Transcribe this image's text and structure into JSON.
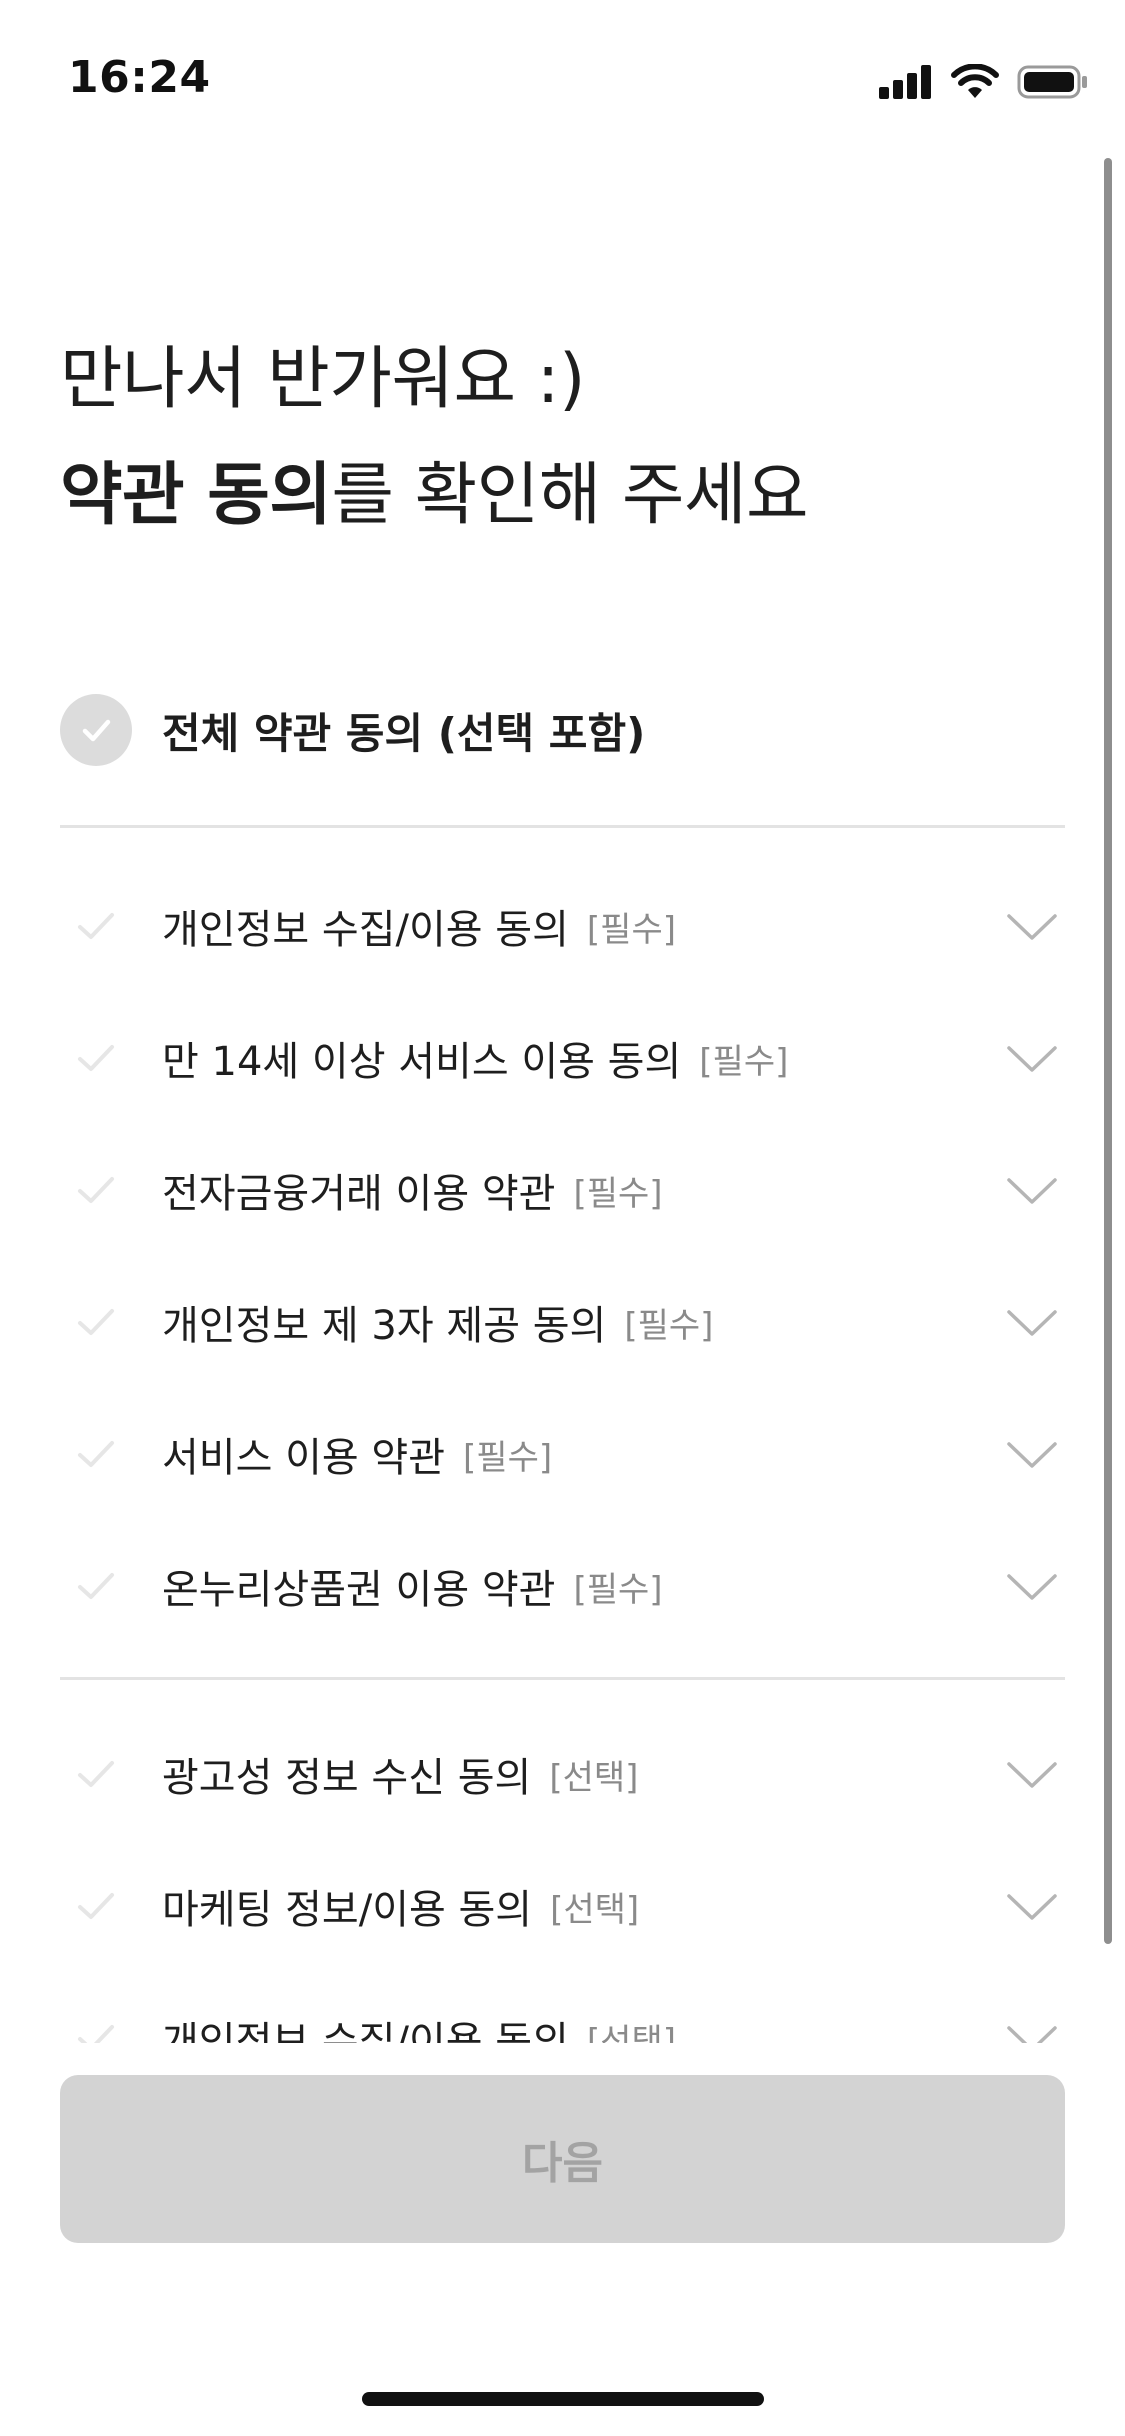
{
  "status_bar": {
    "time": "16:24",
    "icons": [
      "cellular-signal-icon",
      "wifi-icon",
      "battery-icon"
    ]
  },
  "headline": {
    "line1": "만나서 반가워요 :)",
    "line2_bold": "약관 동의",
    "line2_rest": "를 확인해 주세요"
  },
  "all_agree": {
    "label": "전체 약관 동의 (선택 포함)",
    "icon": "check-circle-icon",
    "checked": false
  },
  "required_terms": [
    {
      "label": "개인정보 수집/이용 동의",
      "tag": "[필수]"
    },
    {
      "label": "만 14세 이상 서비스 이용 동의",
      "tag": "[필수]"
    },
    {
      "label": "전자금융거래 이용 약관",
      "tag": "[필수]"
    },
    {
      "label": "개인정보 제 3자 제공 동의",
      "tag": "[필수]"
    },
    {
      "label": "서비스 이용 약관",
      "tag": "[필수]"
    },
    {
      "label": "온누리상품권 이용 약관",
      "tag": "[필수]"
    }
  ],
  "optional_terms": [
    {
      "label": "광고성 정보 수신 동의",
      "tag": "[선택]"
    },
    {
      "label": "마케팅 정보/이용 동의",
      "tag": "[선택]"
    },
    {
      "label": "개인정보 수집/이용 동의",
      "tag": "[선택]"
    }
  ],
  "next_button": {
    "label": "다음",
    "enabled": false
  },
  "colors": {
    "text": "#1e1e1e",
    "tag_text": "#8a8a8a",
    "divider": "#e3e3e3",
    "check_inactive": "#e6e6e6",
    "chevron": "#b5b5b5",
    "button_disabled_bg": "#d3d3d3",
    "button_disabled_text": "#a3a3a3"
  }
}
